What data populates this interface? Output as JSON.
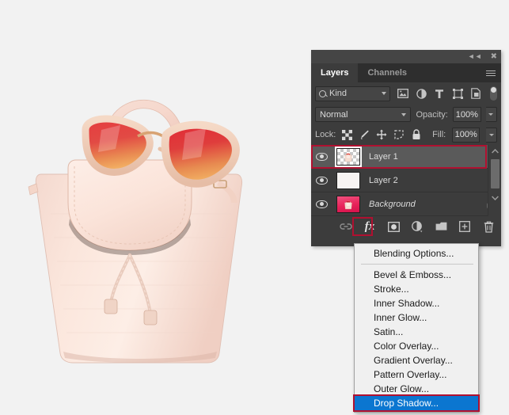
{
  "window": {
    "collapse_icon": "collapse-double-arrow-icon",
    "close_icon": "close-icon"
  },
  "panel": {
    "tabs": [
      {
        "label": "Layers",
        "active": true
      },
      {
        "label": "Channels",
        "active": false
      }
    ],
    "menu_icon": "panel-menu-icon",
    "filter": {
      "search_icon": "search-icon",
      "kind_label": "Kind",
      "icons": [
        "pixel-layer-filter-icon",
        "adjustment-layer-filter-icon",
        "type-layer-filter-icon",
        "shape-layer-filter-icon",
        "smart-object-filter-icon"
      ],
      "toggle": "filter-enable-toggle"
    },
    "blend": {
      "mode": "Normal",
      "opacity_label": "Opacity:",
      "opacity_value": "100%"
    },
    "lock": {
      "label": "Lock:",
      "icons": [
        "lock-transparent-pixels-icon",
        "lock-image-pixels-icon",
        "lock-position-icon",
        "lock-artboard-nesting-icon",
        "lock-all-icon"
      ],
      "fill_label": "Fill:",
      "fill_value": "100%"
    },
    "layers": [
      {
        "name": "Layer 1",
        "selected": true,
        "thumb": "transparent",
        "visible": true,
        "locked": false,
        "italic": false
      },
      {
        "name": "Layer 2",
        "selected": false,
        "thumb": "white",
        "visible": true,
        "locked": false,
        "italic": false
      },
      {
        "name": "Background",
        "selected": false,
        "thumb": "pink",
        "visible": true,
        "locked": true,
        "italic": true
      }
    ],
    "bottom_icons": [
      "link-layers-icon",
      "fx-add-layer-style-icon",
      "add-layer-mask-icon",
      "new-fill-adjustment-layer-icon",
      "new-group-icon",
      "new-layer-icon",
      "delete-layer-icon"
    ],
    "fx_label": "fx"
  },
  "context_menu": {
    "items": [
      {
        "label": "Blending Options...",
        "highlighted": false,
        "separator_after": true
      },
      {
        "label": "Bevel & Emboss...",
        "highlighted": false
      },
      {
        "label": "Stroke...",
        "highlighted": false
      },
      {
        "label": "Inner Shadow...",
        "highlighted": false
      },
      {
        "label": "Inner Glow...",
        "highlighted": false
      },
      {
        "label": "Satin...",
        "highlighted": false
      },
      {
        "label": "Color Overlay...",
        "highlighted": false
      },
      {
        "label": "Gradient Overlay...",
        "highlighted": false
      },
      {
        "label": "Pattern Overlay...",
        "highlighted": false
      },
      {
        "label": "Outer Glow...",
        "highlighted": false
      },
      {
        "label": "Drop Shadow...",
        "highlighted": true
      }
    ]
  },
  "canvas": {
    "artwork": "pink-leather-backpack-with-sunglasses",
    "background_color": "#f2f2f2"
  },
  "colors": {
    "panel_bg": "#3c3c3c",
    "panel_dark": "#2e2e2e",
    "selected_row": "#5a5a5a",
    "highlight_red": "#b01030",
    "menu_blue": "#0b76d0",
    "menu_bg": "#f0f0f0"
  }
}
